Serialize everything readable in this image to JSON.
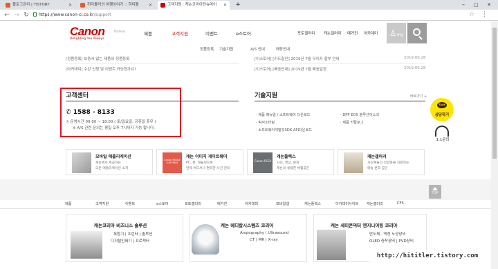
{
  "browser": {
    "tabs": [
      {
        "label": "블로그관리 | TISTORY",
        "color": "#e35c2c"
      },
      {
        "label": "히티틀러의 여행이야기 :: 히티틀",
        "color": "#e35c2c"
      },
      {
        "label": "고객지원 : 캐논코리아컨슈머이",
        "color": "#cc0000"
      }
    ],
    "new_tab": "+",
    "window_controls": [
      "–",
      "□",
      "✕"
    ],
    "url_secure_host": "https://www.canon-ci.co.kr",
    "url_path": "/support",
    "nav_icons": [
      "back-icon",
      "forward-icon",
      "reload-icon"
    ]
  },
  "header": {
    "logo": "Canon",
    "tagline": "Delighting You Always",
    "region": "Korea",
    "gnb": [
      "제품",
      "고객지원",
      "이벤트",
      "e스토어"
    ],
    "gnb_active": 1,
    "top_menu": [
      "포토갤러리",
      "캐논갤러리",
      "매거진",
      "아카데미"
    ],
    "my_label": "my"
  },
  "subnav": [
    "정품등록",
    "기술지원",
    "A/S 안내",
    "매장안내"
  ],
  "notices": {
    "left": [
      "[정품등록] 보증서 없는 제품의 정품등록",
      "[아카데미] 수강 신청 및 이벤트 카능한가요?"
    ],
    "right": [
      {
        "text": "[이스토어] [카드할인] 2019년 7월 무이자 할부 안내",
        "date": "2019.06.28"
      },
      {
        "text": "[이스토어] [배송안내] 2019년 7월 배송일정",
        "date": "2019.06.28"
      }
    ]
  },
  "customer_center": {
    "title": "고객센터",
    "phone": "1588 - 8133",
    "hours": "운영시간 09:00 ~ 18:00 ( 토/일요일, 공휴일 휴무 )",
    "as_note": "※ A/S 관련 문의는 평일 오후 7시까지 가능 합니다."
  },
  "tech_support": {
    "title": "기술지원",
    "more": "바로가기 +",
    "items_left": [
      "제품 매뉴얼 / 소프트웨어 다운로드",
      "픽서소터링",
      "소프트웨어개발킷SDK API다운로드"
    ],
    "items_right": [
      "DPP EOS 솔루션이스크",
      "제품 카탈로그"
    ]
  },
  "quick": {
    "kakao_label": "상담하기",
    "kakao_badge": "TALK",
    "one2one": "1:1문의",
    "top": "TOP"
  },
  "cards": [
    {
      "title": "모바일 애플리케이션",
      "desc1": "캐논에서 제공하는",
      "desc2": "모든 애플리케이션 소개"
    },
    {
      "title": "캐논 이미지 게이트웨이",
      "desc1": "PC, 폰, 태블릿으로",
      "desc2": "언제 어디서나 편리한 사진 관리"
    },
    {
      "title": "캐논플렉스",
      "desc1": "사진, 영상, 문화",
      "desc2": "캐논의 생생한 체험공간"
    },
    {
      "title": "캐논갤러리",
      "desc1": "사진예술의 다양화를 지향하는",
      "desc2": "예술 문화 공간"
    }
  ],
  "card_thumb_labels": [
    "",
    "Canon IMAGE GATEWAY",
    "Canon PLEX",
    ""
  ],
  "sitemap": [
    "제품",
    "고객지원",
    "이벤트",
    "e스토어",
    "포토갤러리",
    "매거진",
    "아카데미",
    "모바일앱",
    "캐논플렉스",
    "아카데미사이트",
    "캐논갤러리",
    "CFS"
  ],
  "banners": [
    {
      "title": "캐논코리아 비즈니스 솔루션",
      "lines": [
        "복합기 | 프린터 | 솔루션",
        "디지털인쇄기 | 프로젝터"
      ]
    },
    {
      "title": "캐논 메디칼시스템즈 코리아",
      "lines": [
        "Angiography | Ultrasound",
        "CT | MR | X-ray"
      ]
    },
    {
      "title": "캐논 세미콘덕터 엔지니어링 코리아",
      "lines": [
        "반도체 · 액정 노광장비",
        "OLED 증착장비 | PVD장비"
      ]
    }
  ],
  "watermark": "http://hititler.tistory.com",
  "colors": {
    "brand": "#cc0000",
    "highlight_box": "#e0141e",
    "kakao": "#fee500"
  }
}
